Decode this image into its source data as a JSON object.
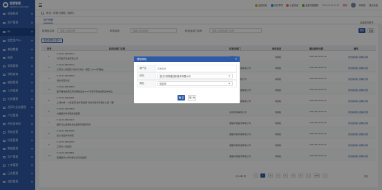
{
  "app": {
    "name": "智慧管理",
    "subtitle": "SMART PLATFORM"
  },
  "header": {
    "items": [
      {
        "label": "全部消息",
        "color": "#f5a623"
      },
      {
        "label": "待办事项",
        "color": "#2e9bf0"
      },
      {
        "label": "公告消息",
        "color": "#ff6b6b"
      },
      {
        "label": "全部流程通知",
        "color": "#52c41a"
      }
    ],
    "datetime": "2024-06-06 13:15",
    "user": "刘晓晓",
    "logout": "退出系统",
    "delete": "删除"
  },
  "sidebar": {
    "items": [
      {
        "label": "低值耗材"
      },
      {
        "label": "资产管理"
      },
      {
        "label": "BI",
        "active": true
      },
      {
        "label": "固定资产BI"
      },
      {
        "label": "基础数据"
      },
      {
        "label": "报表"
      },
      {
        "label": "采购管理"
      },
      {
        "label": "消耗查询"
      },
      {
        "label": "维修管理"
      },
      {
        "label": "入库管理"
      },
      {
        "label": "出库管理"
      },
      {
        "label": "合同与业务管理"
      },
      {
        "label": "产品管理"
      },
      {
        "label": "供应商协同"
      },
      {
        "label": "系统设置"
      },
      {
        "label": "科室管理"
      },
      {
        "label": "数据管理"
      },
      {
        "label": "用户管理"
      },
      {
        "label": "工单管理"
      },
      {
        "label": "日志管理"
      },
      {
        "label": "流程管理"
      },
      {
        "label": "审批中心"
      },
      {
        "label": "开发平台"
      },
      {
        "label": "统计分析"
      }
    ]
  },
  "breadcrumb": {
    "text": "首页 / 导航与授权（临时）"
  },
  "tabs": [
    {
      "label": "用户授权"
    }
  ],
  "filters": {
    "label1": "按角色名称",
    "placeholder1": "请输入角色名称",
    "label2": "机构名称",
    "placeholder2": "请输入机构名称",
    "label3": "科室及部门名称",
    "placeholder3": "请输入科室及部门名称",
    "search": "搜索",
    "reset": "重置",
    "advanced": "高级查询条件"
  },
  "toolbar": {
    "btn": "批量设置(全部) 6"
  },
  "table": {
    "columns": [
      "序号",
      "机构及部门名称",
      "科室及部门",
      "角色状态",
      "最后修改日期",
      "操作"
    ],
    "rows": [
      {
        "idx": "1",
        "code": "F-01-02-06040713",
        "name": "华东医疗科技有限公司",
        "dept": "药事部",
        "status": "待授权",
        "date": "2021-06-18 15:44",
        "ops": "[修改权限] [查看记录]"
      },
      {
        "idx": "2",
        "code": "F-01-02-06040712",
        "name": "江苏省人民医院 消化科 消化一病区（2021年报告）",
        "dept": "华东医疗科技有限公司",
        "status": "待授权",
        "date": "2021-06-18 15:44",
        "ops": "[修改权限] [查看记录]"
      },
      {
        "idx": "3",
        "code": "F-01-02-06040690",
        "name": "消化科室测试",
        "dept": "华东医疗有限公司",
        "status": "待授权",
        "date": "2021-06-18 15:44",
        "ops": "[修改权限] [查看记录]"
      },
      {
        "idx": "4",
        "code": "F-01-02-06040563",
        "name": "医疗器械临床应用管理委员会2021年度专家组成员名单信息",
        "dept": "上海山海集团有限公司",
        "status": "待授权",
        "date": "2021-06-18 15:44",
        "ops": "[修改权限] [查看记录]"
      },
      {
        "idx": "5",
        "code": "F-01-02-06040451",
        "name": "上海市第一人民医院 医学装备部 采购与招标管理办公室（兼）",
        "dept": "上海山海集团有限公司",
        "status": "待授权",
        "date": "2021-06-18 15:44",
        "ops": "[修改权限] [查看记录]"
      },
      {
        "idx": "6",
        "code": "F-01-02-06040339",
        "name": "中国医学科学院肿瘤医院",
        "dept": "北京华康有限公司",
        "status": "待授权",
        "date": "2021-06-18 15:44",
        "ops": "[修改权限] [查看记录]"
      },
      {
        "idx": "7",
        "code": "F-01-02-06040227",
        "name": "国家卫生健康委员会医院管理研究所",
        "dept": "国医华康医疗有限公司",
        "status": "待授权",
        "date": "2021-06-18 15:44",
        "ops": "[修改权限] [查看记录]"
      },
      {
        "idx": "8",
        "code": "F-01-02-06040115",
        "name": "四川省医学科学院",
        "dept": "国医华康科技有限公司",
        "status": "待授权",
        "date": "2021-06-18 15:44",
        "ops": "[修改权限] [查看记录]"
      },
      {
        "idx": "9",
        "code": "F-01-02-06040003",
        "name": "江苏省人民医院",
        "dept": "国医华康科技有限公司",
        "status": "待授权",
        "date": "2021-06-18 15:44",
        "ops": "[修改权限] [查看记录]"
      },
      {
        "idx": "10",
        "code": "F-01-02-06039891",
        "name": "首都医科大学附属北京天坛医院",
        "dept": "国医华康医疗有限公司",
        "status": "待授权",
        "date": "2021-06-18 15:44",
        "ops": "[修改权限] [查看记录]"
      }
    ]
  },
  "pager": {
    "total": "共 1085 条",
    "pages": [
      "‹",
      "1",
      "2",
      "3",
      "4",
      "5",
      "6",
      "…",
      "109",
      "›"
    ],
    "jump": "前往"
  },
  "dialog": {
    "title": "授权角色",
    "close": "×",
    "user_label": "用户名",
    "user_value": "ZJXX2X",
    "org_label": "机构",
    "org_value": "浙江兴邦智能控制技术有限公司",
    "role_label": "角色",
    "role_value": "供应商",
    "ok": "确 定",
    "cancel": "取 消"
  }
}
